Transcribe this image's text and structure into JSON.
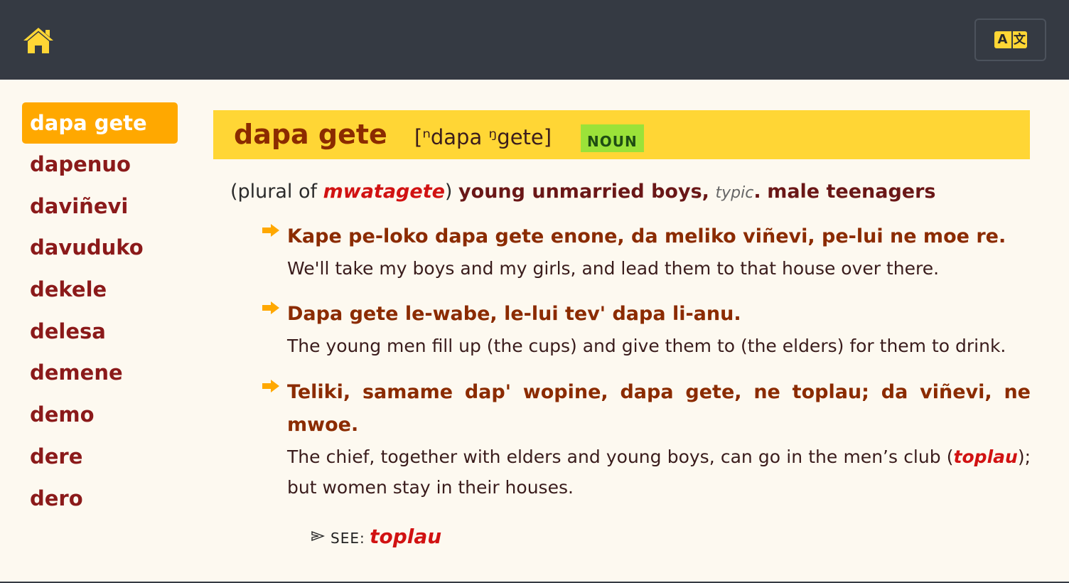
{
  "header": {
    "home_icon": "home-icon",
    "language_icon": "translate-icon",
    "language_label_a": "A",
    "language_label_b": "文"
  },
  "sidebar": {
    "items": [
      {
        "label": "dapa gete",
        "active": true
      },
      {
        "label": "dapenuo"
      },
      {
        "label": "daviñevi"
      },
      {
        "label": "davuduko"
      },
      {
        "label": "dekele"
      },
      {
        "label": "delesa"
      },
      {
        "label": "demene"
      },
      {
        "label": "demo"
      },
      {
        "label": "dere"
      },
      {
        "label": "dero"
      }
    ]
  },
  "entry": {
    "headword": "dapa gete",
    "pronunciation": "[ⁿdapa ᵑgete]",
    "part_of_speech": "NOUN",
    "definition": {
      "prefix": "(plural of ",
      "plural_link": "mwatagete",
      "suffix": ")",
      "gloss_1": "young unmarried boys,",
      "typic": "typic",
      "gloss_2": "male teenagers"
    },
    "examples": [
      {
        "vernacular": "Kape pe-loko dapa gete enone, da meliko viñevi, pe-lui ne moe re.",
        "translation": "We'll take my boys and my girls, and lead them to that house over there."
      },
      {
        "vernacular": "Dapa gete le-wabe, le-lui tev' dapa li-anu.",
        "translation": "The young men fill up (the cups) and give them to (the elders) for them to drink."
      },
      {
        "vernacular": "Teliki, samame dap' wopine, dapa gete, ne toplau; da viñevi, ne mwoe.",
        "translation_before": "The chief, together with elders and young boys, can go in the men’s club (",
        "translation_link": "toplau",
        "translation_after": "); but women stay in their houses."
      }
    ],
    "see_also": {
      "label": "SEE:",
      "link": "toplau"
    }
  },
  "colors": {
    "topbar": "#353a43",
    "accent_yellow": "#ffd635",
    "active_orange": "#ffa800",
    "pos_badge": "#9be239",
    "link_red": "#d11212",
    "headword_brown": "#8b2b00"
  }
}
